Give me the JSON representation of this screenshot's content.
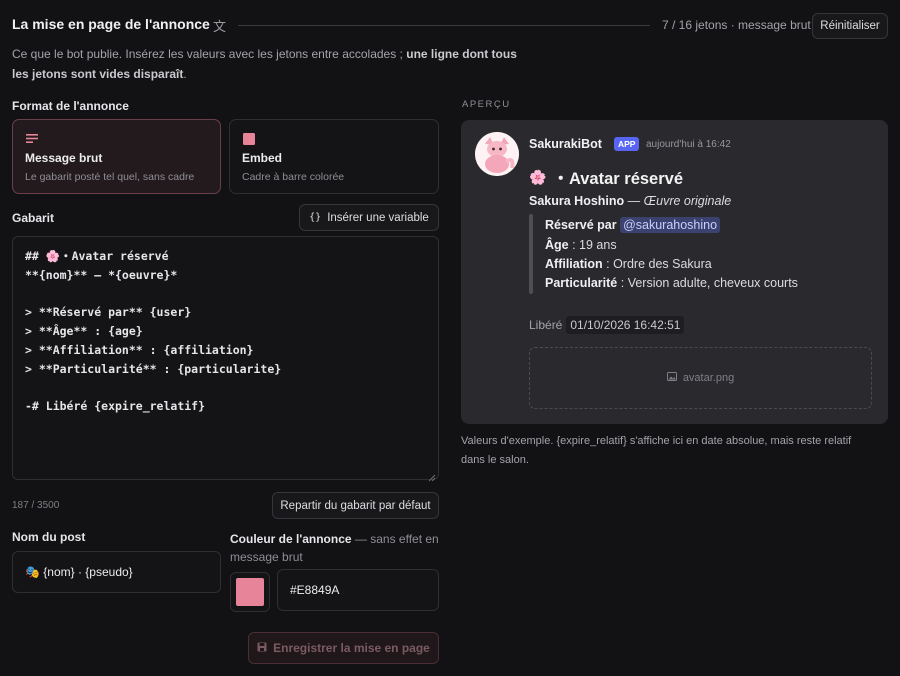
{
  "header": {
    "title": "La mise en page de l'annonce",
    "translate_icon": "文",
    "token_status": "7 / 16 jetons · message brut",
    "reset_label": "Réinitialiser"
  },
  "description": {
    "text": "Ce que le bot publie. Insérez les valeurs avec les jetons entre accolades ; ",
    "bold": "une ligne dont tous les jetons sont vides disparaît",
    "end": "."
  },
  "format": {
    "label": "Format de l'annonce",
    "options": [
      {
        "title": "Message brut",
        "subtitle": "Le gabarit posté tel quel, sans cadre",
        "selected": true,
        "icon": "lines-icon"
      },
      {
        "title": "Embed",
        "subtitle": "Cadre à barre colorée",
        "selected": false,
        "icon": "square-icon"
      }
    ]
  },
  "template": {
    "label": "Gabarit",
    "insert_label": "Insérer une variable",
    "lines": [
      "## 🌸・Avatar réservé",
      "**{nom}** — *{oeuvre}*",
      "",
      "> **Réservé par** {user}",
      "> **Âge** : {age}",
      "> **Affiliation** : {affiliation}",
      "> **Particularité** : {particularite}",
      "",
      "-# Libéré {expire_relatif}"
    ],
    "counter": "187 / 3500",
    "default_label": "Repartir du gabarit par défaut"
  },
  "post_name": {
    "label": "Nom du post",
    "value": "🎭 {nom} · {pseudo}"
  },
  "color": {
    "label": "Couleur de l'annonce",
    "hint": " — sans effet en message brut",
    "value": "#E8849A"
  },
  "save_label": "Enregistrer la mise en page",
  "preview": {
    "section_label": "APERÇU",
    "bot_name": "SakurakiBot",
    "app_badge": "APP",
    "timestamp": "aujourd'hui à 16:42",
    "heading_emoji": "🌸",
    "heading": "・Avatar réservé",
    "name": "Sakura Hoshino",
    "dash": " — ",
    "work": "Œuvre originale",
    "fields": [
      {
        "key": "Réservé par",
        "sep": " ",
        "value": "@sakurahoshino",
        "mention": true
      },
      {
        "key": "Âge",
        "sep": " : ",
        "value": "19 ans"
      },
      {
        "key": "Affiliation",
        "sep": " : ",
        "value": "Ordre des Sakura"
      },
      {
        "key": "Particularité",
        "sep": " : ",
        "value": "Version adulte, cheveux courts"
      }
    ],
    "liberated_label": "Libéré",
    "liberated_date": "01/10/2026 16:42:51",
    "image_name": "avatar.png"
  },
  "note": "Valeurs d'exemple. {expire_relatif} s'affiche ici en date absolue, mais reste relatif dans le salon."
}
